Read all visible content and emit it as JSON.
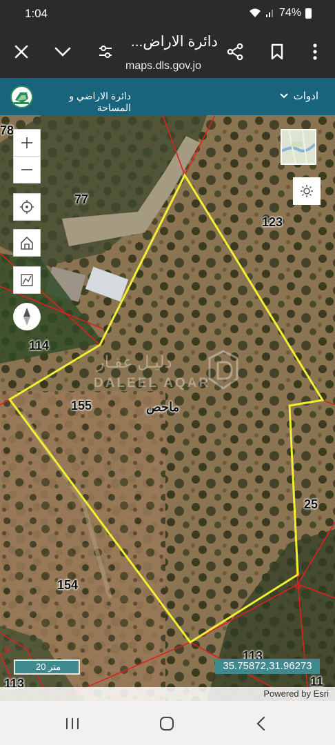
{
  "status_bar": {
    "time": "1:04",
    "battery": "74%"
  },
  "browser": {
    "title": "دائرة الاراض...",
    "url": "maps.dls.gov.jo",
    "icons": [
      "close-icon",
      "chevron-down-icon",
      "tune-icon",
      "share-icon",
      "bookmark-icon",
      "more-vert-icon"
    ]
  },
  "app_header": {
    "org_name": "دائرة الاراضي و المساحة",
    "tools_label": "ادوات"
  },
  "map": {
    "parcels": [
      "78",
      "77",
      "123",
      "114",
      "155",
      "25",
      "154",
      "113",
      "113",
      "11"
    ],
    "site_name": "ماحص",
    "watermark_ar": "دليـل عقـار",
    "watermark_en": "DALEEL AQAR",
    "scale": "20 متر",
    "coordinates": "35.75872,31.96273",
    "attribution": "Powered by Esri",
    "controls": [
      "zoom-in-icon",
      "zoom-out-icon",
      "locate-icon",
      "home-icon",
      "measure-icon",
      "compass-icon",
      "basemap-thumbnail",
      "brightness-icon"
    ],
    "colors": {
      "selected_parcel": "#f0f030",
      "parcel_boundary": "#e02020",
      "header": "#17647c",
      "scale_bg": "#3f8a8f"
    }
  },
  "nav_bar": {
    "icons": [
      "recent-apps-icon",
      "home-button-icon",
      "back-icon"
    ]
  }
}
